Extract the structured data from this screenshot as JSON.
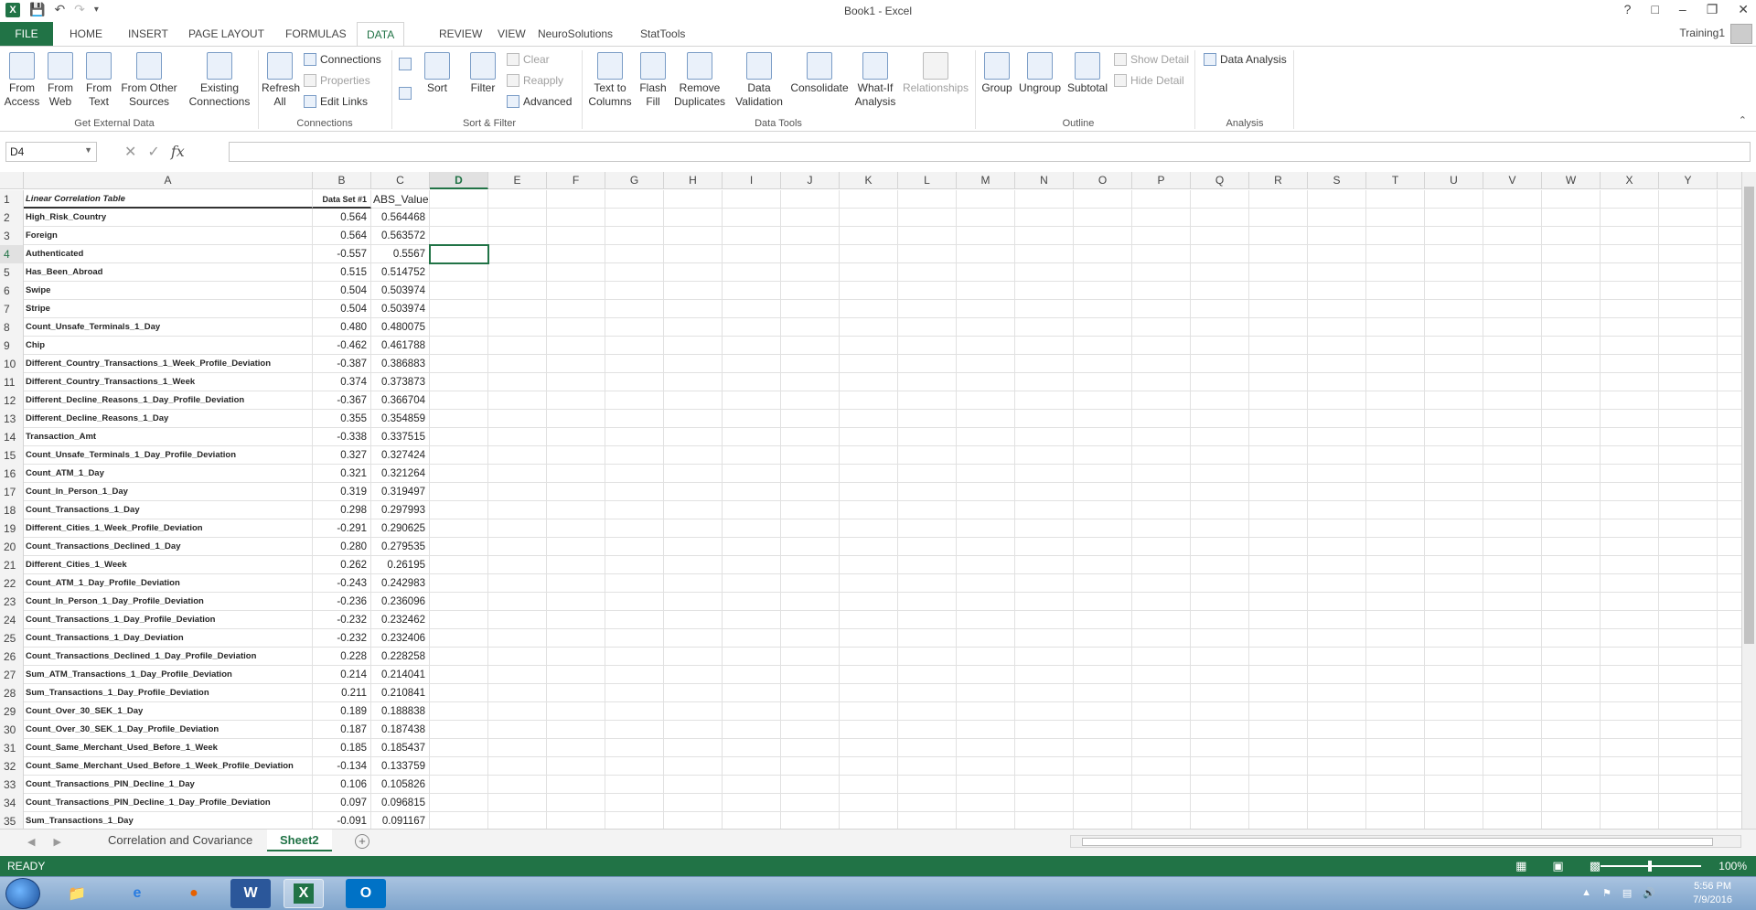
{
  "window": {
    "title": "Book1 - Excel",
    "user": "Training1",
    "help": "?",
    "controls": [
      "–",
      "❐",
      "✕"
    ]
  },
  "tabs": [
    "FILE",
    "HOME",
    "INSERT",
    "PAGE LAYOUT",
    "FORMULAS",
    "DATA",
    "REVIEW",
    "VIEW",
    "NeuroSolutions",
    "StatTools"
  ],
  "active_tab": "DATA",
  "ribbon": {
    "get_external_data": {
      "label": "Get External Data",
      "buttons": [
        "From Access",
        "From Web",
        "From Text",
        "From Other Sources",
        "Existing Connections"
      ]
    },
    "connections": {
      "label": "Connections",
      "refresh": "Refresh All",
      "items": [
        "Connections",
        "Properties",
        "Edit Links"
      ]
    },
    "sort_filter": {
      "label": "Sort & Filter",
      "sort": "Sort",
      "filter": "Filter",
      "items": [
        "Clear",
        "Reapply",
        "Advanced"
      ]
    },
    "data_tools": {
      "label": "Data Tools",
      "buttons": [
        "Text to Columns",
        "Flash Fill",
        "Remove Duplicates",
        "Data Validation",
        "Consolidate",
        "What-If Analysis",
        "Relationships"
      ]
    },
    "outline": {
      "label": "Outline",
      "buttons": [
        "Group",
        "Ungroup",
        "Subtotal"
      ],
      "items": [
        "Show Detail",
        "Hide Detail"
      ]
    },
    "analysis": {
      "label": "Analysis",
      "button": "Data Analysis"
    }
  },
  "formula_bar": {
    "name_box": "D4",
    "formula": "",
    "fx": "fx"
  },
  "columns": [
    "A",
    "B",
    "C",
    "D",
    "E",
    "F",
    "G",
    "H",
    "I",
    "J",
    "K",
    "L",
    "M",
    "N",
    "O",
    "P",
    "Q",
    "R",
    "S",
    "T",
    "U",
    "V",
    "W",
    "X",
    "Y"
  ],
  "selected_cell": "D4",
  "rows": [
    {
      "n": "1",
      "a": "Linear Correlation Table",
      "b": "Data Set #1",
      "c": "ABS_Value"
    },
    {
      "n": "2",
      "a": "High_Risk_Country",
      "b": "0.564",
      "c": "0.564468"
    },
    {
      "n": "3",
      "a": "Foreign",
      "b": "0.564",
      "c": "0.563572"
    },
    {
      "n": "4",
      "a": "Authenticated",
      "b": "-0.557",
      "c": "0.5567"
    },
    {
      "n": "5",
      "a": "Has_Been_Abroad",
      "b": "0.515",
      "c": "0.514752"
    },
    {
      "n": "6",
      "a": "Swipe",
      "b": "0.504",
      "c": "0.503974"
    },
    {
      "n": "7",
      "a": "Stripe",
      "b": "0.504",
      "c": "0.503974"
    },
    {
      "n": "8",
      "a": "Count_Unsafe_Terminals_1_Day",
      "b": "0.480",
      "c": "0.480075"
    },
    {
      "n": "9",
      "a": "Chip",
      "b": "-0.462",
      "c": "0.461788"
    },
    {
      "n": "10",
      "a": "Different_Country_Transactions_1_Week_Profile_Deviation",
      "b": "-0.387",
      "c": "0.386883"
    },
    {
      "n": "11",
      "a": "Different_Country_Transactions_1_Week",
      "b": "0.374",
      "c": "0.373873"
    },
    {
      "n": "12",
      "a": "Different_Decline_Reasons_1_Day_Profile_Deviation",
      "b": "-0.367",
      "c": "0.366704"
    },
    {
      "n": "13",
      "a": "Different_Decline_Reasons_1_Day",
      "b": "0.355",
      "c": "0.354859"
    },
    {
      "n": "14",
      "a": "Transaction_Amt",
      "b": "-0.338",
      "c": "0.337515"
    },
    {
      "n": "15",
      "a": "Count_Unsafe_Terminals_1_Day_Profile_Deviation",
      "b": "0.327",
      "c": "0.327424"
    },
    {
      "n": "16",
      "a": "Count_ATM_1_Day",
      "b": "0.321",
      "c": "0.321264"
    },
    {
      "n": "17",
      "a": "Count_In_Person_1_Day",
      "b": "0.319",
      "c": "0.319497"
    },
    {
      "n": "18",
      "a": "Count_Transactions_1_Day",
      "b": "0.298",
      "c": "0.297993"
    },
    {
      "n": "19",
      "a": "Different_Cities_1_Week_Profile_Deviation",
      "b": "-0.291",
      "c": "0.290625"
    },
    {
      "n": "20",
      "a": "Count_Transactions_Declined_1_Day",
      "b": "0.280",
      "c": "0.279535"
    },
    {
      "n": "21",
      "a": "Different_Cities_1_Week",
      "b": "0.262",
      "c": "0.26195"
    },
    {
      "n": "22",
      "a": "Count_ATM_1_Day_Profile_Deviation",
      "b": "-0.243",
      "c": "0.242983"
    },
    {
      "n": "23",
      "a": "Count_In_Person_1_Day_Profile_Deviation",
      "b": "-0.236",
      "c": "0.236096"
    },
    {
      "n": "24",
      "a": "Count_Transactions_1_Day_Profile_Deviation",
      "b": "-0.232",
      "c": "0.232462"
    },
    {
      "n": "25",
      "a": "Count_Transactions_1_Day_Deviation",
      "b": "-0.232",
      "c": "0.232406"
    },
    {
      "n": "26",
      "a": "Count_Transactions_Declined_1_Day_Profile_Deviation",
      "b": "0.228",
      "c": "0.228258"
    },
    {
      "n": "27",
      "a": "Sum_ATM_Transactions_1_Day_Profile_Deviation",
      "b": "0.214",
      "c": "0.214041"
    },
    {
      "n": "28",
      "a": "Sum_Transactions_1_Day_Profile_Deviation",
      "b": "0.211",
      "c": "0.210841"
    },
    {
      "n": "29",
      "a": "Count_Over_30_SEK_1_Day",
      "b": "0.189",
      "c": "0.188838"
    },
    {
      "n": "30",
      "a": "Count_Over_30_SEK_1_Day_Profile_Deviation",
      "b": "0.187",
      "c": "0.187438"
    },
    {
      "n": "31",
      "a": "Count_Same_Merchant_Used_Before_1_Week",
      "b": "0.185",
      "c": "0.185437"
    },
    {
      "n": "32",
      "a": "Count_Same_Merchant_Used_Before_1_Week_Profile_Deviation",
      "b": "-0.134",
      "c": "0.133759"
    },
    {
      "n": "33",
      "a": "Count_Transactions_PIN_Decline_1_Day",
      "b": "0.106",
      "c": "0.105826"
    },
    {
      "n": "34",
      "a": "Count_Transactions_PIN_Decline_1_Day_Profile_Deviation",
      "b": "0.097",
      "c": "0.096815"
    },
    {
      "n": "35",
      "a": "Sum_Transactions_1_Day",
      "b": "-0.091",
      "c": "0.091167"
    }
  ],
  "sheets": [
    "Correlation and Covariance",
    "Sheet2"
  ],
  "active_sheet": "Sheet2",
  "status": {
    "ready": "READY",
    "zoom": "100%"
  },
  "taskbar": {
    "time": "5:56 PM",
    "date": "7/9/2016"
  },
  "colors": {
    "excel_green": "#217346"
  }
}
